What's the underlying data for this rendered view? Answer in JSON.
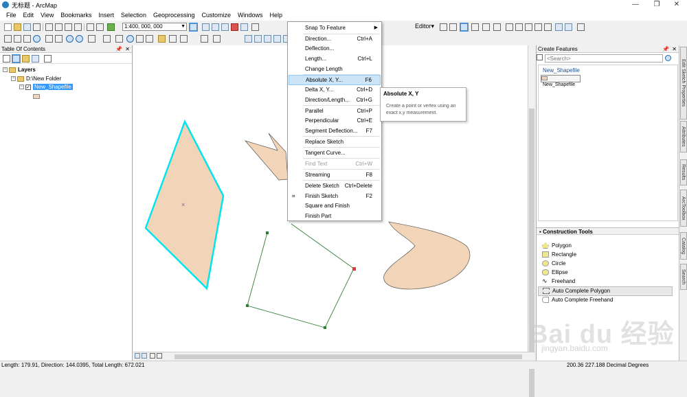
{
  "window": {
    "title": "无标题 - ArcMap",
    "min": "—",
    "max": "❐",
    "close": "✕"
  },
  "menu": [
    "File",
    "Edit",
    "View",
    "Bookmarks",
    "Insert",
    "Selection",
    "Geoprocessing",
    "Customize",
    "Windows",
    "Help"
  ],
  "toolbar": {
    "scale": "1:400, 000, 000",
    "editor_label": "Editor▾"
  },
  "toc": {
    "title": "Table Of Contents",
    "layers_label": "Layers",
    "folder_label": "D:\\New Folder",
    "layer_name": "New_Shapefile"
  },
  "create_features": {
    "title": "Create Features",
    "search_placeholder": "<Search>",
    "template_group": "New_Shapefile",
    "template_item": "New_Shapefile"
  },
  "construction_tools": {
    "title": "Construction Tools",
    "tools": [
      "Polygon",
      "Rectangle",
      "Circle",
      "Ellipse",
      "Freehand",
      "Auto Complete Polygon",
      "Auto Complete Freehand"
    ],
    "selected": "Auto Complete Polygon"
  },
  "context_menu": {
    "items": [
      {
        "label": "Snap To Feature",
        "shortcut": "",
        "submenu": true
      },
      {
        "label": "Direction...",
        "shortcut": "Ctrl+A"
      },
      {
        "label": "Deflection...",
        "shortcut": ""
      },
      {
        "label": "Length...",
        "shortcut": "Ctrl+L"
      },
      {
        "label": "Change Length",
        "shortcut": ""
      },
      {
        "label": "Absolute X, Y...",
        "shortcut": "F6",
        "highlighted": true
      },
      {
        "label": "Delta X, Y...",
        "shortcut": "Ctrl+D"
      },
      {
        "label": "Direction/Length...",
        "shortcut": "Ctrl+G"
      },
      {
        "label": "Parallel",
        "shortcut": "Ctrl+P"
      },
      {
        "label": "Perpendicular",
        "shortcut": "Ctrl+E"
      },
      {
        "label": "Segment Deflection...",
        "shortcut": "F7"
      },
      {
        "label": "Replace Sketch",
        "shortcut": ""
      },
      {
        "label": "Tangent Curve...",
        "shortcut": ""
      },
      {
        "label": "Find Text",
        "shortcut": "Ctrl+W",
        "disabled": true
      },
      {
        "label": "Streaming",
        "shortcut": "F8"
      },
      {
        "label": "Delete Sketch",
        "shortcut": "Ctrl+Delete"
      },
      {
        "label": "Finish Sketch",
        "shortcut": "F2"
      },
      {
        "label": "Square and Finish",
        "shortcut": ""
      },
      {
        "label": "Finish Part",
        "shortcut": ""
      }
    ]
  },
  "tooltip": {
    "title": "Absolute X, Y",
    "description": "Create a point or vertex using an exact x,y measurement."
  },
  "side_tabs": [
    "Edit Sketch Properties",
    "Attributes",
    "Results",
    "ArcToolbox",
    "Catalog",
    "Search"
  ],
  "status": {
    "left": "Length: 179.91, Direction: 144.0395, Total Length: 672.021",
    "right": "200.36  227.188 Decimal Degrees"
  },
  "watermark": {
    "text": "Bai du 经验",
    "url": "jingyan.baidu.com"
  },
  "colors": {
    "polygon_fill": "#f2d5b8",
    "selection": "#00e5ee",
    "sketch_line": "#2e7d32",
    "menu_highlight": "#cce4f7"
  }
}
